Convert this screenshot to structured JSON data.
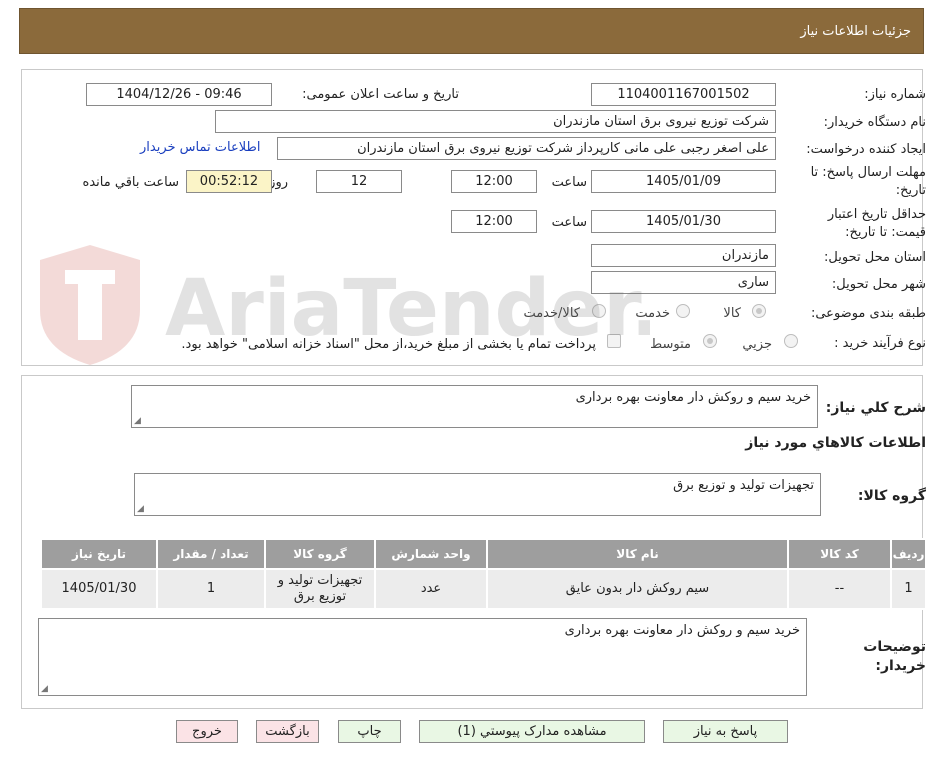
{
  "header": {
    "title": "جزئیات اطلاعات نیاز"
  },
  "form": {
    "need_number_label": "شماره نیاز:",
    "need_number": "1104001167001502",
    "announce_label": "تاریخ و ساعت اعلان عمومی:",
    "announce_value": "1404/12/26 - 09:46",
    "buyer_org_label": "نام دستگاه خریدار:",
    "buyer_org": "شرکت توزیع نیروی برق استان مازندران",
    "requester_label": "ایجاد کننده درخواست:",
    "requester": "علی اصغر رجبی علی مانی کارپرداز شرکت توزیع نیروی برق استان مازندران",
    "contact_link": "اطلاعات تماس خریدار",
    "deadline_label_1": "مهلت ارسال پاسخ: تا",
    "deadline_label_2": "تاریخ:",
    "deadline_date": "1405/01/09",
    "time_label": "ساعت",
    "deadline_time": "12:00",
    "days": "12",
    "days_and_label": "روز و",
    "remaining": "00:52:12",
    "remaining_label": "ساعت باقي مانده",
    "validity_label_1": "حداقل تاریخ اعتبار",
    "validity_label_2": "قیمت: تا تاریخ:",
    "validity_date": "1405/01/30",
    "validity_time": "12:00",
    "province_label": "استان محل تحویل:",
    "province": "مازندران",
    "city_label": "شهر محل تحویل:",
    "city": "ساری",
    "category_label": "طبقه بندی موضوعی:",
    "category_options": [
      "کالا",
      "خدمت",
      "کالا/خدمت"
    ],
    "process_label": "نوع فرآیند خرید :",
    "process_options": [
      "جزیي",
      "متوسط"
    ],
    "payment_note": "پرداخت تمام یا بخشی از مبلغ خرید،از محل \"اسناد خزانه اسلامی\" خواهد بود."
  },
  "items": {
    "summary_label": "شرح کلي نياز:",
    "summary": "خرید سیم و روکش دار معاونت بهره برداری",
    "goods_info_title": "اطلاعات کالاهاي مورد نياز",
    "goods_group_label": "گروه کالا:",
    "goods_group": "تجهیزات تولید و توزیع برق",
    "table": {
      "headers": [
        "رديف",
        "کد کالا",
        "نام کالا",
        "واحد شمارش",
        "گروه کالا",
        "تعداد / مقدار",
        "تاریخ نیاز"
      ],
      "rows": [
        [
          "1",
          "--",
          "سیم روکش دار بدون عایق",
          "عدد",
          "تجهیزات تولید و توزیع برق",
          "1",
          "1405/01/30"
        ]
      ]
    },
    "buyer_notes_label_1": "توضیحات",
    "buyer_notes_label_2": "خریدار:",
    "buyer_notes": "خرید سیم و روکش دار معاونت بهره برداری"
  },
  "buttons": {
    "reply": "پاسخ به نیاز",
    "attachments": "مشاهده مدارک پیوستي (1)",
    "print": "چاپ",
    "back": "بازگشت",
    "exit": "خروج"
  },
  "colors": {
    "header_bg": "#8b6a3b",
    "table_header_bg": "#9e9e9e",
    "link": "#1a3fbf"
  }
}
